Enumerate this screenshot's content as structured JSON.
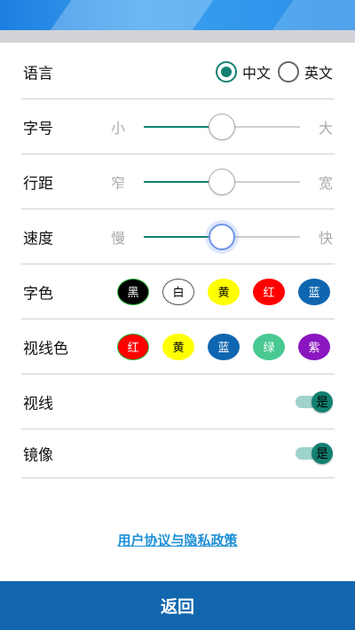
{
  "settings": {
    "language": {
      "label": "语言",
      "options": [
        {
          "label": "中文",
          "checked": true
        },
        {
          "label": "英文",
          "checked": false
        }
      ]
    },
    "font_size": {
      "label": "字号",
      "min_label": "小",
      "max_label": "大",
      "value": 0.5
    },
    "line_spacing": {
      "label": "行距",
      "min_label": "窄",
      "max_label": "宽",
      "value": 0.5
    },
    "speed": {
      "label": "速度",
      "min_label": "慢",
      "max_label": "快",
      "value": 0.5
    },
    "font_color": {
      "label": "字色",
      "options": [
        {
          "label": "黑",
          "bg": "#000000",
          "fg": "#ffffff",
          "border": "#26b33a"
        },
        {
          "label": "白",
          "bg": "#ffffff",
          "fg": "#000000",
          "border": "#555555"
        },
        {
          "label": "黄",
          "bg": "#ffff00",
          "fg": "#000000",
          "border": "#ffff00"
        },
        {
          "label": "红",
          "bg": "#ff0000",
          "fg": "#ffffff",
          "border": "#ff0000"
        },
        {
          "label": "蓝",
          "bg": "#0f66b0",
          "fg": "#ffffff",
          "border": "#0f66b0"
        }
      ]
    },
    "sight_color": {
      "label": "视线色",
      "options": [
        {
          "label": "红",
          "bg": "#ff0000",
          "fg": "#ffffff",
          "border": "#26b33a"
        },
        {
          "label": "黄",
          "bg": "#ffff00",
          "fg": "#000000",
          "border": "#ffff00"
        },
        {
          "label": "蓝",
          "bg": "#0f66b0",
          "fg": "#ffffff",
          "border": "#0f66b0"
        },
        {
          "label": "绿",
          "bg": "#49c992",
          "fg": "#ffffff",
          "border": "#49c992"
        },
        {
          "label": "紫",
          "bg": "#8a16c0",
          "fg": "#ffffff",
          "border": "#8a16c0"
        }
      ]
    },
    "sight_line": {
      "label": "视线",
      "switch_text": "是",
      "on": true
    },
    "mirror": {
      "label": "镜像",
      "switch_text": "是",
      "on": true
    }
  },
  "footer": {
    "agreement_link": "用户协议与隐私政策",
    "back_label": "返回"
  },
  "colors": {
    "accent": "#138172",
    "primary": "#1166ae",
    "link": "#1e90d6"
  }
}
